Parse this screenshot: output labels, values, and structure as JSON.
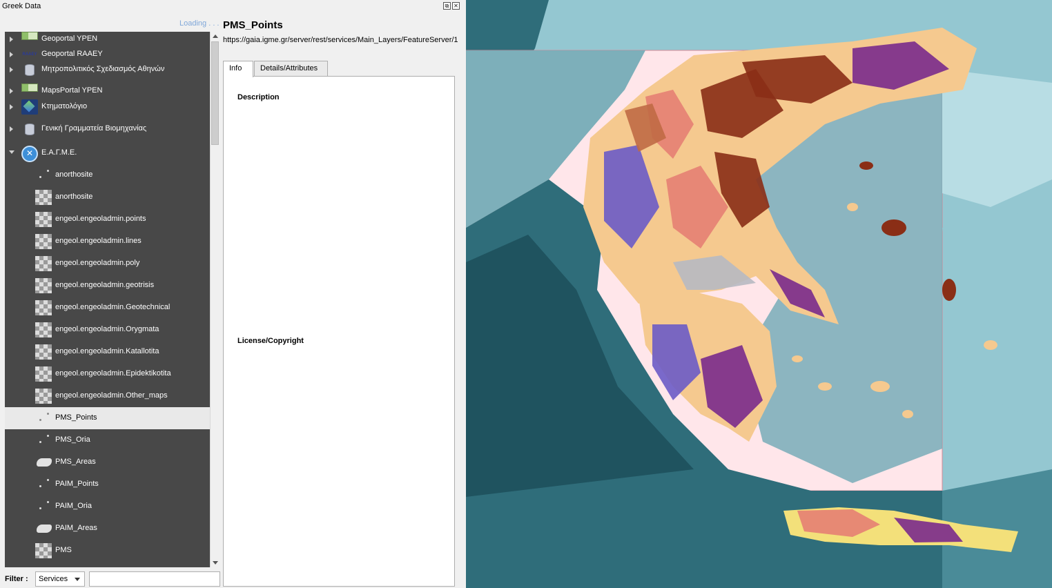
{
  "panel": {
    "title": "Greek Data",
    "loading_text": "Loading . . .",
    "float_glyph": "⧉",
    "close_glyph": "✕"
  },
  "tree": {
    "items": [
      {
        "label": "Geoportal YPEN",
        "icon": "geoportal-icon",
        "level": 0,
        "expander": "collapsed"
      },
      {
        "label": "Geoportal RAAEY",
        "icon": "raaey-logo-icon",
        "level": 0,
        "expander": "collapsed"
      },
      {
        "label": "Μητροπολιτικός Σχεδιασμός Αθηνών",
        "icon": "database-icon",
        "level": 0,
        "expander": "collapsed"
      },
      {
        "label": "MapsPortal YPEN",
        "icon": "geoportal-icon",
        "level": 0,
        "expander": "collapsed"
      },
      {
        "label": "Κτηματολόγιο",
        "icon": "cadastre-icon",
        "level": 0,
        "expander": "collapsed"
      },
      {
        "label": "Γενική Γραμματεία Βιομηχανίας",
        "icon": "database-icon",
        "level": 0,
        "expander": "collapsed"
      },
      {
        "label": "Ε.Α.Γ.Μ.Ε.",
        "icon": "eagme-icon",
        "level": 0,
        "expander": "expanded"
      },
      {
        "label": "anorthosite",
        "icon": "point-layer-icon",
        "level": 1
      },
      {
        "label": "anorthosite",
        "icon": "raster-layer-icon",
        "level": 1
      },
      {
        "label": "engeol.engeoladmin.points",
        "icon": "raster-layer-icon",
        "level": 1
      },
      {
        "label": "engeol.engeoladmin.lines",
        "icon": "raster-layer-icon",
        "level": 1
      },
      {
        "label": "engeol.engeoladmin.poly",
        "icon": "raster-layer-icon",
        "level": 1
      },
      {
        "label": "engeol.engeoladmin.geotrisis",
        "icon": "raster-layer-icon",
        "level": 1
      },
      {
        "label": "engeol.engeoladmin.Geotechnical",
        "icon": "raster-layer-icon",
        "level": 1
      },
      {
        "label": "engeol.engeoladmin.Orygmata",
        "icon": "raster-layer-icon",
        "level": 1
      },
      {
        "label": "engeol.engeoladmin.Katallotita",
        "icon": "raster-layer-icon",
        "level": 1
      },
      {
        "label": "engeol.engeoladmin.Epidektikotita",
        "icon": "raster-layer-icon",
        "level": 1
      },
      {
        "label": "engeol.engeoladmin.Other_maps",
        "icon": "raster-layer-icon",
        "level": 1
      },
      {
        "label": "PMS_Points",
        "icon": "point-layer-icon",
        "level": 1,
        "selected": true
      },
      {
        "label": "PMS_Oria",
        "icon": "point-layer-icon",
        "level": 1
      },
      {
        "label": "PMS_Areas",
        "icon": "polygon-layer-icon",
        "level": 1
      },
      {
        "label": "PAIM_Points",
        "icon": "point-layer-icon",
        "level": 1
      },
      {
        "label": "PAIM_Oria",
        "icon": "point-layer-icon",
        "level": 1
      },
      {
        "label": "PAIM_Areas",
        "icon": "polygon-layer-icon",
        "level": 1
      },
      {
        "label": "PMS",
        "icon": "raster-layer-icon",
        "level": 1
      }
    ]
  },
  "filter": {
    "label": "Filter :",
    "selected": "Services",
    "value": ""
  },
  "info": {
    "title": "PMS_Points",
    "url": "https://gaia.igme.gr/server/rest/services/Main_Layers/FeatureServer/1",
    "tabs": [
      "Info",
      "Details/Attributes"
    ],
    "description_label": "Description",
    "license_label": "License/Copyright"
  },
  "map": {
    "sea_colors": [
      "#1c4f5a",
      "#2f6d7a",
      "#4a8b98",
      "#6fa9b5",
      "#94c7d1",
      "#b8dde4"
    ],
    "land_colors": [
      "#f5c98f",
      "#e67f73",
      "#6b5bc7",
      "#7a2a8c",
      "#8a2e16",
      "#f3e07a",
      "#b7b9c2",
      "#c06a45"
    ],
    "extent_fill": "#ffe6ea"
  }
}
